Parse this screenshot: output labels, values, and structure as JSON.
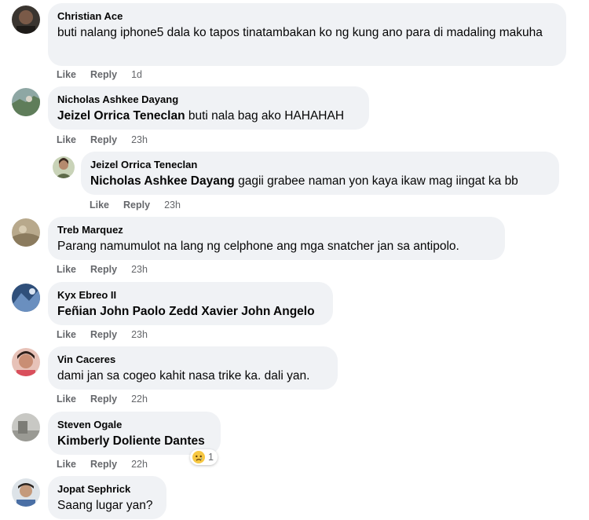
{
  "actions": {
    "like": "Like",
    "reply": "Reply"
  },
  "comments": [
    {
      "author": "Christian Ace",
      "mention": "",
      "text": "buti nalang iphone5 dala ko tapos tinatambakan ko ng kung ano para di madaling makuha",
      "time": "1d",
      "avatar": "avatar-christian-ace"
    },
    {
      "author": "Nicholas Ashkee Dayang",
      "mention": "Jeizel Orrica Teneclan",
      "text": " buti nala bag ako HAHAHAH",
      "time": "23h",
      "avatar": "avatar-nicholas"
    },
    {
      "author": "Jeizel Orrica Teneclan",
      "mention": "Nicholas Ashkee Dayang",
      "text": " gagii grabee naman yon kaya ikaw mag iingat ka bb",
      "time": "23h",
      "avatar": "avatar-jeizel"
    },
    {
      "author": "Treb Marquez",
      "mention": "",
      "text": "Parang namumulot na lang ng celphone ang mga snatcher jan sa antipolo.",
      "time": "23h",
      "avatar": "avatar-treb"
    },
    {
      "author": "Kyx Ebreo II",
      "mention": "Feñian John Paolo Zedd Xavier John Angelo",
      "text": "",
      "time": "23h",
      "avatar": "avatar-kyx"
    },
    {
      "author": "Vin Caceres",
      "mention": "",
      "text": "dami jan sa cogeo kahit nasa trike ka. dali yan.",
      "time": "22h",
      "avatar": "avatar-vin"
    },
    {
      "author": "Steven Ogale",
      "mention": "Kimberly Doliente Dantes",
      "text": "",
      "time": "22h",
      "avatar": "avatar-steven",
      "reaction": {
        "emoji": "sad-emoji",
        "count": "1"
      }
    },
    {
      "author": "Jopat Sephrick",
      "mention": "",
      "text": "Saang lugar yan?",
      "time": "",
      "avatar": "avatar-jopat"
    }
  ]
}
